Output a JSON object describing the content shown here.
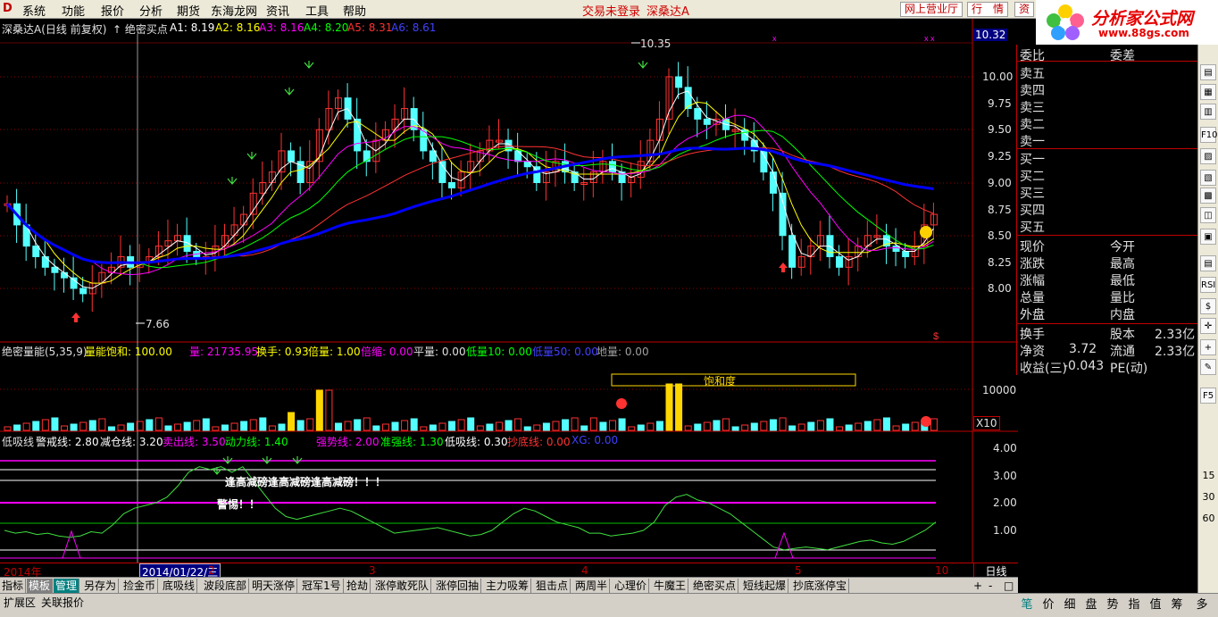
{
  "menu": {
    "logo": "D",
    "items": [
      "系统",
      "功能",
      "报价",
      "分析",
      "期货",
      "东海龙网",
      "资讯",
      "工具",
      "帮助"
    ],
    "center": [
      "交易未登录",
      "深桑达A"
    ],
    "right_buttons": [
      "网上营业厅",
      "行　情",
      "资"
    ]
  },
  "brand": {
    "name": "分析家公式网",
    "url": "www.88gs.com"
  },
  "chart_header": {
    "stock": "深桑达A",
    "mode": "(日线 前复权)",
    "indicator": "绝密买点",
    "a1": "A1: 8.19",
    "a2": "A2: 8.16",
    "a3": "A3: 8.16",
    "a4": "A4: 8.20",
    "a5": "A5: 8.31",
    "a6": "A6: 8.61"
  },
  "price_axis": {
    "current": "10.32",
    "ticks": [
      "10.00",
      "9.75",
      "9.50",
      "9.25",
      "9.00",
      "8.75",
      "8.50",
      "8.25",
      "8.00"
    ],
    "high_label": "10.35",
    "low_label": "7.66"
  },
  "volume_header": {
    "name": "绝密量能(5,35,9)",
    "sat": "量能饱和: 100.00",
    "vol": "量: 21735.95",
    "turn": "换手: 0.93",
    "bei": "倍量: 1.00",
    "suo": "倍缩: 0.00",
    "ping": "平量: 0.00",
    "di": "低量10: 0.00",
    "low50": "低量50: 0.00",
    "di2": "地量: 0.00"
  },
  "volume_axis": {
    "tick": "10000",
    "mult": "X10",
    "sat_label": "饱和度"
  },
  "osc_header": {
    "a": "低吸线",
    "b": "警戒线: 2.80",
    "c": "减仓线: 3.20",
    "d": "卖出线: 3.50",
    "e": "动力线: 1.40",
    "f": "强势线: 2.00",
    "g": "准强线: 1.30",
    "h": "低吸线: 0.30",
    "i": "抄底线: 0.00",
    "j": "XG: 0.00"
  },
  "osc_axis": [
    "4.00",
    "3.00",
    "2.00",
    "1.00"
  ],
  "osc_notes": {
    "n1": "逢高减磅逢高减磅逢高减磅！！！",
    "n2": "警惕！！"
  },
  "dates": {
    "year": "2014年",
    "selected": "2014/01/22/三",
    "months": [
      "2",
      "3",
      "4",
      "5",
      "10"
    ],
    "period": "日线"
  },
  "right_panel": {
    "wb": "委比",
    "wc": "委差",
    "sells": [
      "卖五",
      "卖四",
      "卖三",
      "卖二",
      "卖一"
    ],
    "buys": [
      "买一",
      "买二",
      "买三",
      "买四",
      "买五"
    ],
    "stats": [
      [
        "现价",
        "今开"
      ],
      [
        "涨跌",
        "最高"
      ],
      [
        "涨幅",
        "最低"
      ],
      [
        "总量",
        "量比"
      ],
      [
        "外盘",
        "内盘"
      ]
    ],
    "info": [
      [
        "换手",
        "股本",
        "2.33亿"
      ],
      [
        "净资",
        "3.72",
        "流通",
        "2.33亿"
      ],
      [
        "收益(三)",
        "-0.043",
        "PE(动)"
      ]
    ]
  },
  "toolbar_right": [
    "F10",
    "F5",
    "15",
    "30",
    "60",
    "RSI"
  ],
  "tabs": [
    "指标",
    "模板",
    "管理",
    "另存为",
    "捡金币",
    "底吸线",
    "波段底部",
    "明天涨停",
    "冠军1号",
    "抢劫",
    "涨停敢死队",
    "涨停回抽",
    "主力吸筹",
    "狙击点",
    "两周半",
    "心理价",
    "牛魔王",
    "绝密买点",
    "短线起爆",
    "抄底涨停宝"
  ],
  "tab_ctrl": [
    "+",
    "-",
    "□"
  ],
  "bottom": {
    "left": [
      "扩展区",
      "关联报价"
    ],
    "right": [
      "笔",
      "价",
      "细",
      "盘",
      "势",
      "指",
      "值",
      "筹",
      "多"
    ]
  },
  "colors": {
    "up": "#ff3232",
    "down": "#54ffff",
    "ma": "#0000ff",
    "accent": "#c00000"
  }
}
